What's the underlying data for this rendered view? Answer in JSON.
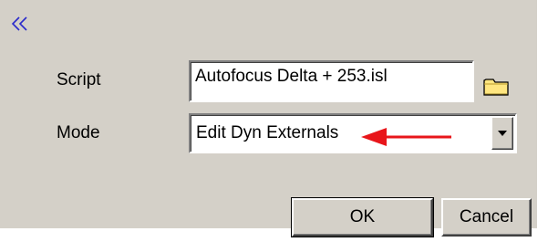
{
  "toolbar": {
    "collapse_icon": "double-chevron-left-icon",
    "collapse_color": "#2a2acc"
  },
  "form": {
    "script_label": "Script",
    "script_value": "Autofocus Delta + 253.isl",
    "browse_icon": "folder-icon",
    "mode_label": "Mode",
    "mode_value": "Edit Dyn Externals",
    "dropdown_icon": "chevron-down-icon",
    "annotation_icon": "red-arrow-icon",
    "annotation_color": "#e8151a"
  },
  "buttons": {
    "ok_label": "OK",
    "cancel_label": "Cancel"
  },
  "colors": {
    "dialog_background": "#d4d0c8",
    "field_background": "#ffffff",
    "folder_fill": "#ffe680"
  }
}
